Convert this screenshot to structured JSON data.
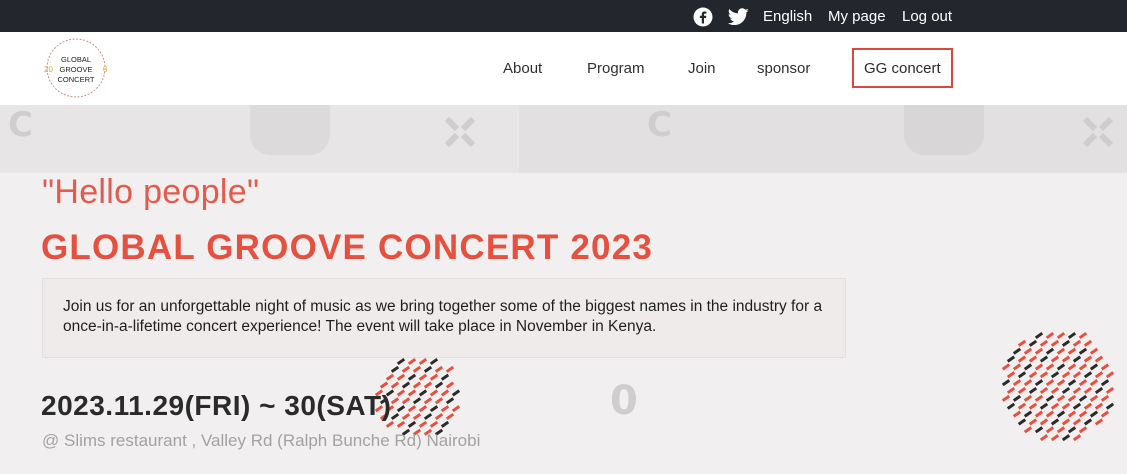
{
  "topbar": {
    "facebook_icon": "facebook-icon",
    "twitter_icon": "twitter-icon",
    "language": "English",
    "mypage": "My page",
    "logout": "Log out"
  },
  "logo": {
    "line1": "GLOBAL",
    "line2": "GROOVE",
    "line3": "CONCERT",
    "left_digits": "20",
    "right_digits": "0"
  },
  "nav": {
    "items": [
      {
        "label": "About"
      },
      {
        "label": "Program"
      },
      {
        "label": "Join"
      },
      {
        "label": "sponsor"
      },
      {
        "label": "GG concert"
      }
    ]
  },
  "hero": {
    "greeting": "\"Hello people\"",
    "title": "GLOBAL GROOVE CONCERT 2023",
    "description": "Join us for an unforgettable night of music as we bring together some of the biggest names in the industry for a once-in-a-lifetime concert experience! The event will take place in November in Kenya.",
    "date": "2023.11.29(FRI) ~ 30(SAT)",
    "venue": "@ Slims restaurant , Valley Rd (Ralph Bunche Rd) Nairobi",
    "deco_zero": "0"
  },
  "colors": {
    "accent": "#e6503f",
    "topbar_bg": "#24262d",
    "dark_dot": "#2b2b2b"
  }
}
